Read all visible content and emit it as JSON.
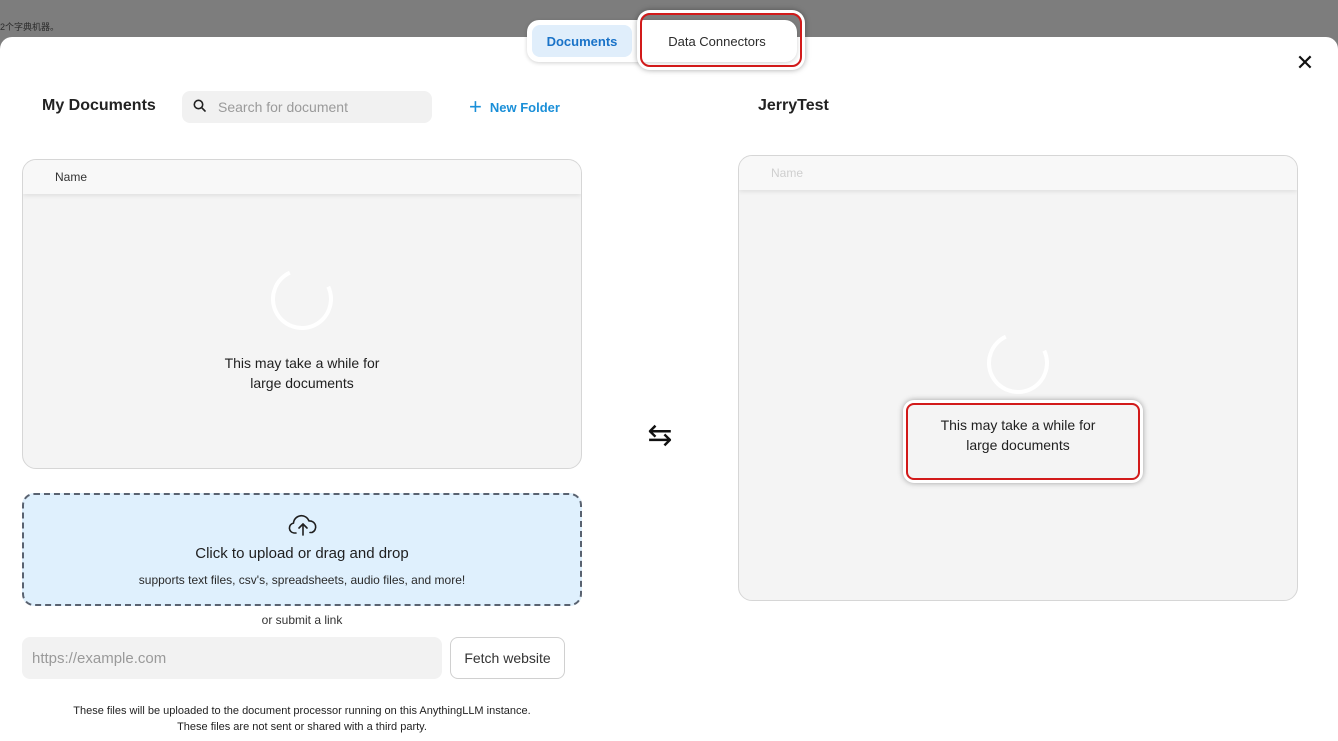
{
  "backdrop": {
    "snippet": "2个字典机器。"
  },
  "tabs": [
    {
      "label": "Documents",
      "active": true
    },
    {
      "label": "Data Connectors",
      "active": false
    }
  ],
  "left": {
    "title": "My Documents",
    "search_placeholder": "Search for document",
    "new_folder_label": "New Folder",
    "column_name": "Name",
    "loading_line1": "This may take a while for",
    "loading_line2": "large documents"
  },
  "right": {
    "title": "JerryTest",
    "column_name": "Name",
    "loading_line1": "This may take a while for",
    "loading_line2": "large documents"
  },
  "upload": {
    "title": "Click to upload or drag and drop",
    "subtitle": "supports text files, csv's, spreadsheets, audio files, and more!"
  },
  "link": {
    "or_text": "or submit a link",
    "url_placeholder": "https://example.com",
    "fetch_label": "Fetch website"
  },
  "footnote": {
    "line1": "These files will be uploaded to the document processor running on this AnythingLLM instance.",
    "line2": "These files are not sent or shared with a third party."
  },
  "icons": {
    "close": "close-icon",
    "search": "search-icon",
    "plus": "plus-icon",
    "swap": "swap-arrows-icon",
    "upload": "cloud-upload-icon"
  },
  "colors": {
    "accent": "#1a8fd8",
    "active_tab_bg": "#e0eefb",
    "upload_bg": "#dff0fd",
    "highlight": "#d21a1a"
  }
}
